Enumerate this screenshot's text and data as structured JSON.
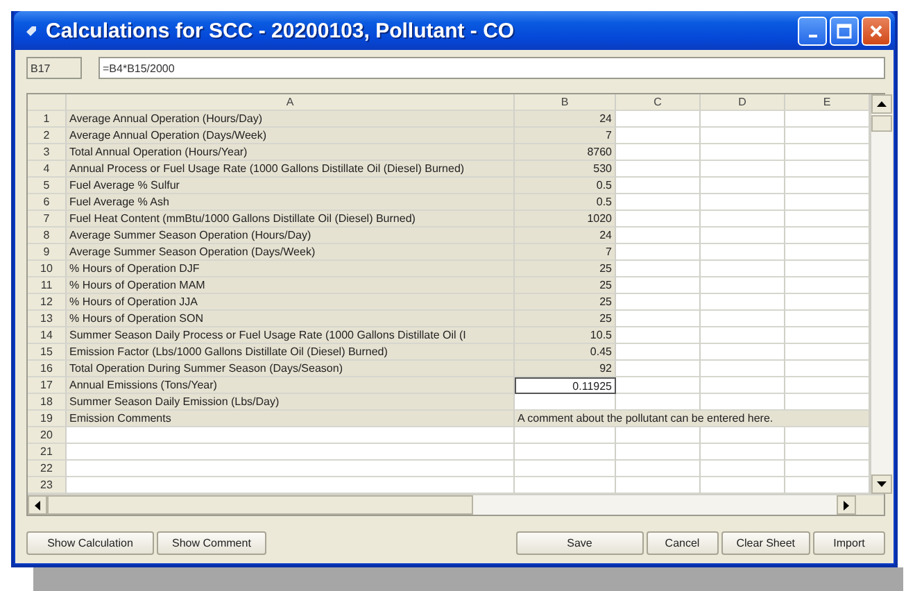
{
  "window": {
    "title": "Calculations for SCC - 20200103, Pollutant - CO"
  },
  "cell_reference": "B17",
  "formula": "=B4*B15/2000",
  "columns": [
    "A",
    "B",
    "C",
    "D",
    "E"
  ],
  "rows": [
    {
      "number": "1",
      "kind": "input",
      "label": "Average Annual Operation (Hours/Day)",
      "value": "24",
      "selected": false
    },
    {
      "number": "2",
      "kind": "input",
      "label": "Average Annual Operation (Days/Week)",
      "value": "7",
      "selected": false
    },
    {
      "number": "3",
      "kind": "input",
      "label": "Total Annual Operation (Hours/Year)",
      "value": "8760",
      "selected": false
    },
    {
      "number": "4",
      "kind": "input",
      "label": "Annual Process or Fuel Usage Rate (1000 Gallons Distillate Oil (Diesel) Burned)",
      "value": "530",
      "selected": false
    },
    {
      "number": "5",
      "kind": "input",
      "label": "Fuel Average % Sulfur",
      "value": "0.5",
      "selected": false
    },
    {
      "number": "6",
      "kind": "input",
      "label": "Fuel Average % Ash",
      "value": "0.5",
      "selected": false
    },
    {
      "number": "7",
      "kind": "input",
      "label": "Fuel Heat Content (mmBtu/1000 Gallons Distillate Oil (Diesel) Burned)",
      "value": "1020",
      "selected": false
    },
    {
      "number": "8",
      "kind": "input",
      "label": "Average Summer Season Operation (Hours/Day)",
      "value": "24",
      "selected": false
    },
    {
      "number": "9",
      "kind": "input",
      "label": "Average Summer Season Operation (Days/Week)",
      "value": "7",
      "selected": false
    },
    {
      "number": "10",
      "kind": "input",
      "label": "% Hours of Operation DJF",
      "value": "25",
      "selected": false
    },
    {
      "number": "11",
      "kind": "input",
      "label": "% Hours of Operation MAM",
      "value": "25",
      "selected": false
    },
    {
      "number": "12",
      "kind": "input",
      "label": "% Hours of Operation JJA",
      "value": "25",
      "selected": false
    },
    {
      "number": "13",
      "kind": "input",
      "label": "% Hours of Operation SON",
      "value": "25",
      "selected": false
    },
    {
      "number": "14",
      "kind": "input",
      "label": "Summer Season Daily Process or Fuel Usage Rate (1000 Gallons Distillate Oil (I",
      "value": "10.5",
      "selected": false
    },
    {
      "number": "15",
      "kind": "input",
      "label": "Emission Factor (Lbs/1000 Gallons Distillate Oil (Diesel) Burned)",
      "value": "0.45",
      "selected": false
    },
    {
      "number": "16",
      "kind": "input",
      "label": "Total Operation During Summer Season (Days/Season)",
      "value": "92",
      "selected": false
    },
    {
      "number": "17",
      "kind": "output",
      "label": "Annual Emissions (Tons/Year)",
      "value": "0.11925",
      "selected": true
    },
    {
      "number": "18",
      "kind": "output",
      "label": "Summer Season Daily Emission (Lbs/Day)",
      "selected": false
    },
    {
      "number": "19",
      "kind": "comment",
      "label": "Emission Comments",
      "value": "A comment about the pollutant can be entered here.",
      "selected": false
    },
    {
      "number": "20",
      "kind": "empty",
      "selected": false
    },
    {
      "number": "21",
      "kind": "empty",
      "selected": false
    },
    {
      "number": "22",
      "kind": "empty",
      "selected": false
    },
    {
      "number": "23",
      "kind": "empty",
      "selected": false
    }
  ],
  "left_buttons": [
    "Show Calculation",
    "Show Comment"
  ],
  "right_buttons": [
    "Save",
    "Cancel",
    "Clear Sheet",
    "Import"
  ]
}
